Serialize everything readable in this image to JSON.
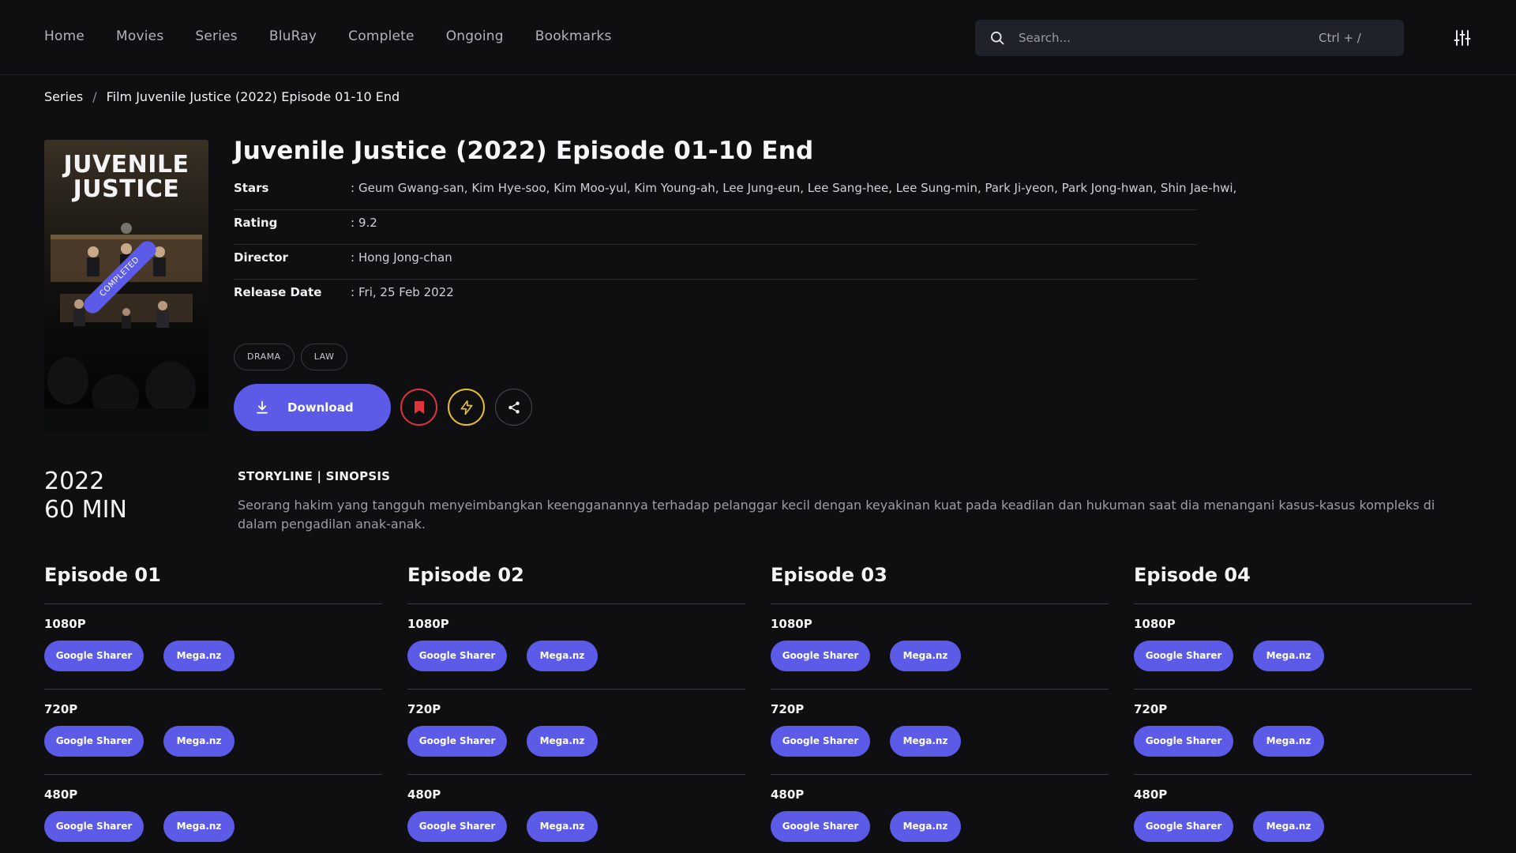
{
  "nav": {
    "items": [
      "Home",
      "Movies",
      "Series",
      "BluRay",
      "Complete",
      "Ongoing",
      "Bookmarks"
    ]
  },
  "search": {
    "placeholder": "Search...",
    "shortcut": "Ctrl + /"
  },
  "breadcrumb": {
    "parent": "Series",
    "separator": "/",
    "current": "Film Juvenile Justice (2022) Episode 01-10 End"
  },
  "poster": {
    "title_line1": "JUVENILE",
    "title_line2": "JUSTICE",
    "badge": "COMPLETED"
  },
  "title": "Juvenile Justice (2022) Episode 01-10 End",
  "meta": [
    {
      "key": "Stars",
      "value": "Geum Gwang-san, Kim Hye-soo, Kim Moo-yul, Kim Young-ah, Lee Jung-eun, Lee Sang-hee, Lee Sung-min, Park Ji-yeon, Park Jong-hwan, Shin Jae-hwi,"
    },
    {
      "key": "Rating",
      "value": "9.2"
    },
    {
      "key": "Director",
      "value": "Hong Jong-chan"
    },
    {
      "key": "Release Date",
      "value": "Fri, 25 Feb 2022"
    }
  ],
  "meta_colon": ":",
  "tags": [
    "DRAMA",
    "LAW"
  ],
  "actions": {
    "download_label": "Download"
  },
  "info": {
    "year": "2022",
    "duration": "60 MIN"
  },
  "synopsis": {
    "heading": "STORYLINE | SINOPSIS",
    "text": "Seorang hakim yang tangguh menyeimbangkan keengganannya terhadap pelanggar kecil dengan keyakinan kuat pada keadilan dan hukuman saat dia menangani kasus-kasus kompleks di dalam pengadilan anak-anak."
  },
  "episodes": [
    {
      "title": "Episode 01",
      "qualities": [
        {
          "label": "1080P",
          "links": [
            "Google Sharer",
            "Mega.nz"
          ]
        },
        {
          "label": "720P",
          "links": [
            "Google Sharer",
            "Mega.nz"
          ]
        },
        {
          "label": "480P",
          "links": [
            "Google Sharer",
            "Mega.nz"
          ]
        }
      ]
    },
    {
      "title": "Episode 02",
      "qualities": [
        {
          "label": "1080P",
          "links": [
            "Google Sharer",
            "Mega.nz"
          ]
        },
        {
          "label": "720P",
          "links": [
            "Google Sharer",
            "Mega.nz"
          ]
        },
        {
          "label": "480P",
          "links": [
            "Google Sharer",
            "Mega.nz"
          ]
        }
      ]
    },
    {
      "title": "Episode 03",
      "qualities": [
        {
          "label": "1080P",
          "links": [
            "Google Sharer",
            "Mega.nz"
          ]
        },
        {
          "label": "720P",
          "links": [
            "Google Sharer",
            "Mega.nz"
          ]
        },
        {
          "label": "480P",
          "links": [
            "Google Sharer",
            "Mega.nz"
          ]
        }
      ]
    },
    {
      "title": "Episode 04",
      "qualities": [
        {
          "label": "1080P",
          "links": [
            "Google Sharer",
            "Mega.nz"
          ]
        },
        {
          "label": "720P",
          "links": [
            "Google Sharer",
            "Mega.nz"
          ]
        },
        {
          "label": "480P",
          "links": [
            "Google Sharer",
            "Mega.nz"
          ]
        }
      ]
    }
  ],
  "colors": {
    "accent": "#5b5be8",
    "bookmark": "#d9363c",
    "flash": "#e8c12a",
    "background": "#0f0f12"
  },
  "icons": {
    "search": "search-icon",
    "filter": "sliders-icon",
    "download": "download-icon",
    "bookmark": "bookmark-icon",
    "flash": "lightning-icon",
    "share": "share-icon"
  }
}
